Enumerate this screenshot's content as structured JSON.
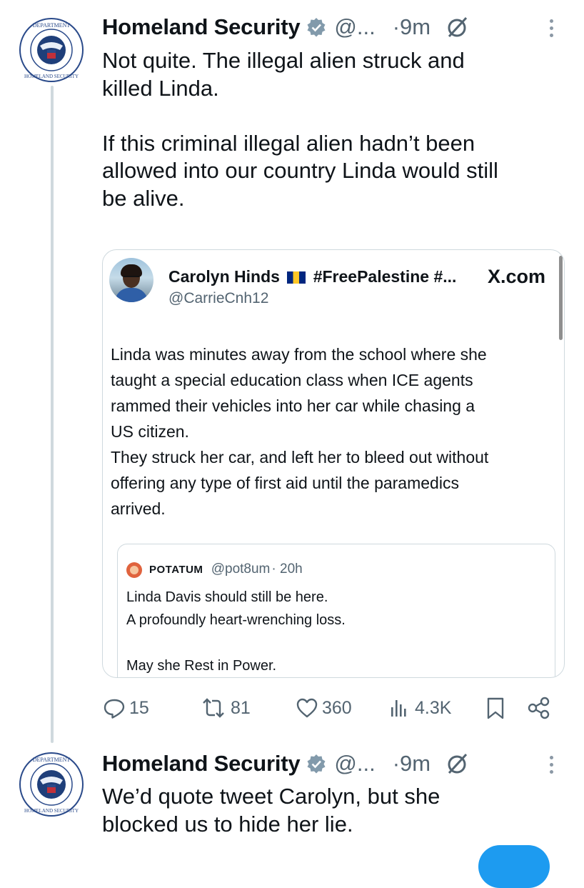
{
  "tweets": [
    {
      "author": "Homeland Security",
      "handle": "@...",
      "time": "·9m",
      "text": "Not quite. The illegal alien struck and\nkilled Linda.\n\nIf this criminal illegal alien hadn’t been\nallowed into our country Linda would still\nbe alive."
    },
    {
      "author": "Homeland Security",
      "handle": "@...",
      "time": "·9m",
      "text": "We’d quote tweet Carolyn, but she\nblocked us to hide her lie."
    }
  ],
  "quote": {
    "name_before_flag": "Carolyn Hinds",
    "name_after_flag": "#FreePalestine #...",
    "handle": "@CarrieCnh12",
    "source": "X.com",
    "text": "Linda was minutes away from the school where she\ntaught a special education class when ICE agents\nrammed their vehicles into her car while chasing a\nUS citizen.\nThey struck her car, and left her to bleed out without\noffering any type of first aid until the paramedics\narrived.",
    "inner": {
      "name": "POTATUM",
      "handle": "@pot8um",
      "time": "· 20h",
      "text": "Linda Davis should still be here.\nA profoundly heart-wrenching loss.\n\nMay she Rest in Power."
    }
  },
  "actions": {
    "replies": "15",
    "reposts": "81",
    "likes": "360",
    "views": "4.3K"
  },
  "icons": [
    "dhs-seal-icon",
    "verified-badge-icon",
    "grok-icon",
    "more-icon",
    "reply-icon",
    "repost-icon",
    "like-icon",
    "views-icon",
    "bookmark-icon",
    "share-icon",
    "barbados-flag-icon"
  ],
  "colors": {
    "text": "#0f1419",
    "secondary": "#536471",
    "border": "#cfd9de",
    "accent": "#1d9bf0"
  }
}
